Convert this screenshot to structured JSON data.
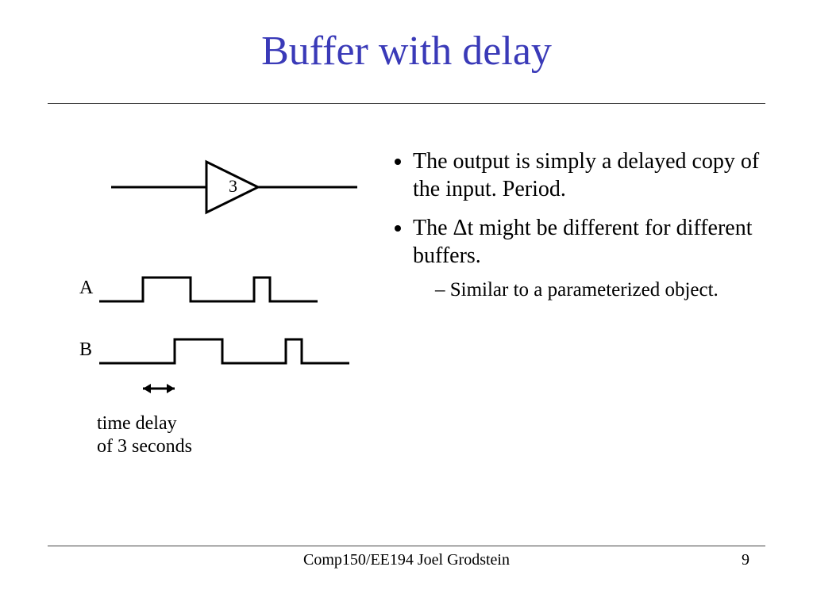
{
  "title": "Buffer with delay",
  "buffer": {
    "value": "3"
  },
  "signals": {
    "a_label": "A",
    "b_label": "B"
  },
  "delay_caption": {
    "line1": "time delay",
    "line2": "of 3 seconds"
  },
  "bullets": {
    "item1": "The output is simply a delayed copy of the input. Period.",
    "item2": "The Δt might be different for different buffers.",
    "sub1": "Similar to a parameterized object."
  },
  "footer": {
    "center": "Comp150/EE194 Joel Grodstein",
    "page": "9"
  }
}
